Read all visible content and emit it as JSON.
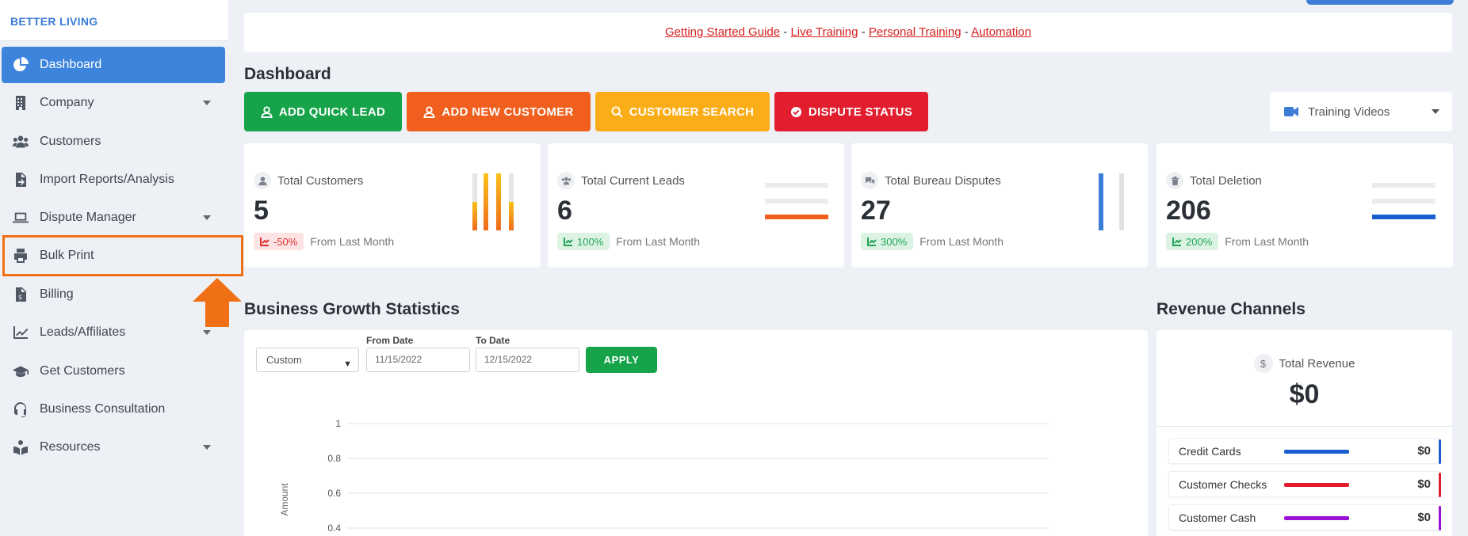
{
  "sidebar": {
    "brand": "BETTER LIVING",
    "items": [
      {
        "label": "Dashboard",
        "icon": "pie-chart-icon"
      },
      {
        "label": "Company",
        "icon": "building-icon"
      },
      {
        "label": "Customers",
        "icon": "users-icon"
      },
      {
        "label": "Import Reports/Analysis",
        "icon": "file-import-icon"
      },
      {
        "label": "Dispute Manager",
        "icon": "laptop-icon"
      },
      {
        "label": "Bulk Print",
        "icon": "printer-icon"
      },
      {
        "label": "Billing",
        "icon": "invoice-icon"
      },
      {
        "label": "Leads/Affiliates",
        "icon": "chart-line-icon"
      },
      {
        "label": "Get Customers",
        "icon": "graduation-cap-icon"
      },
      {
        "label": "Business Consultation",
        "icon": "headset-icon"
      },
      {
        "label": "Resources",
        "icon": "book-reader-icon"
      }
    ]
  },
  "banner": {
    "links": [
      "Getting Started Guide",
      "Live Training",
      "Personal Training",
      "Automation"
    ],
    "separator": "-"
  },
  "page_title": "Dashboard",
  "actions": {
    "quick_lead": "ADD QUICK LEAD",
    "new_customer": "ADD NEW CUSTOMER",
    "customer_search": "CUSTOMER SEARCH",
    "dispute_status": "DISPUTE STATUS",
    "training_videos": "Training Videos"
  },
  "stats": [
    {
      "label": "Total Customers",
      "value": "5",
      "delta": "-50%",
      "delta_type": "negative",
      "note": "From Last Month"
    },
    {
      "label": "Total Current Leads",
      "value": "6",
      "delta": "100%",
      "delta_type": "positive",
      "note": "From Last Month"
    },
    {
      "label": "Total Bureau Disputes",
      "value": "27",
      "delta": "300%",
      "delta_type": "positive",
      "note": "From Last Month"
    },
    {
      "label": "Total Deletion",
      "value": "206",
      "delta": "200%",
      "delta_type": "positive",
      "note": "From Last Month"
    }
  ],
  "growth": {
    "title": "Business Growth Statistics",
    "range": "Custom",
    "from_label": "From Date",
    "from_value": "11/15/2022",
    "to_label": "To Date",
    "to_value": "12/15/2022",
    "apply": "APPLY"
  },
  "chart_data": {
    "type": "line",
    "title": "",
    "xlabel": "",
    "ylabel": "Amount",
    "ylim": [
      0.4,
      1
    ],
    "yticks": [
      "1",
      "0.8",
      "0.6",
      "0.4"
    ],
    "grid": true,
    "series": []
  },
  "revenue": {
    "title": "Revenue Channels",
    "total_label": "Total Revenue",
    "total_value": "$0",
    "channels": [
      {
        "name": "Credit Cards",
        "amount": "$0",
        "color": "#1a5fce"
      },
      {
        "name": "Customer Checks",
        "amount": "$0",
        "color": "#e11d2e"
      },
      {
        "name": "Customer Cash",
        "amount": "$0",
        "color": "#9b10d6"
      }
    ]
  },
  "colors": {
    "active_nav": "#3d84dc",
    "highlight": "#f07016",
    "green": "#16a34a",
    "orange": "#f05f1e",
    "yellow": "#fbad18",
    "red": "#e11d2e"
  }
}
